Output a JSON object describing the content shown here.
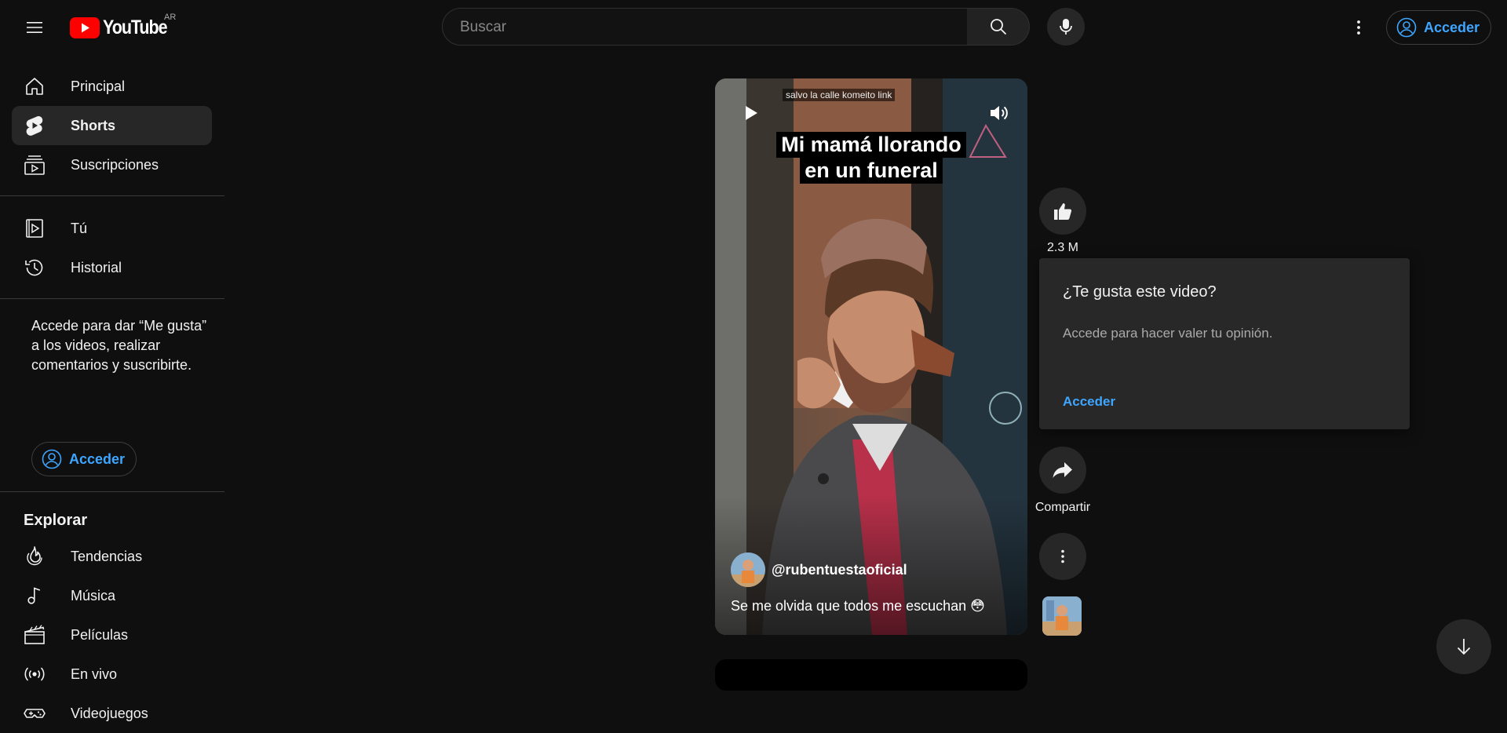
{
  "header": {
    "logo_text": "YouTube",
    "country_code": "AR",
    "search_placeholder": "Buscar",
    "signin_label": "Acceder"
  },
  "sidebar": {
    "primary": [
      {
        "label": "Principal",
        "icon": "home-icon"
      },
      {
        "label": "Shorts",
        "icon": "shorts-icon",
        "active": true
      },
      {
        "label": "Suscripciones",
        "icon": "subscriptions-icon"
      }
    ],
    "you": [
      {
        "label": "Tú",
        "icon": "you-icon"
      },
      {
        "label": "Historial",
        "icon": "history-icon"
      }
    ],
    "signin_prompt": "Accede para dar “Me gusta” a los videos, realizar comentarios y suscribirte.",
    "signin_label": "Acceder",
    "explore_title": "Explorar",
    "explore": [
      {
        "label": "Tendencias",
        "icon": "trending-icon"
      },
      {
        "label": "Música",
        "icon": "music-icon"
      },
      {
        "label": "Películas",
        "icon": "movies-icon"
      },
      {
        "label": "En vivo",
        "icon": "live-icon"
      },
      {
        "label": "Videojuegos",
        "icon": "gaming-icon"
      }
    ]
  },
  "short": {
    "music_tag": "salvo la calle komeito link",
    "caption_lines": [
      "Mi mamá llorando",
      "en un funeral"
    ],
    "channel": "@rubentuestaoficial",
    "title": "Se me olvida que todos me escuchan 😳"
  },
  "actions": {
    "like_count": "2.3 M",
    "share_label": "Compartir"
  },
  "popup": {
    "title": "¿Te gusta este video?",
    "body": "Accede para hacer valer tu opinión.",
    "link": "Acceder"
  },
  "colors": {
    "background": "#0f0f0f",
    "accent_blue": "#3ea6ff",
    "youtube_red": "#ff0000",
    "surface": "#272727"
  }
}
